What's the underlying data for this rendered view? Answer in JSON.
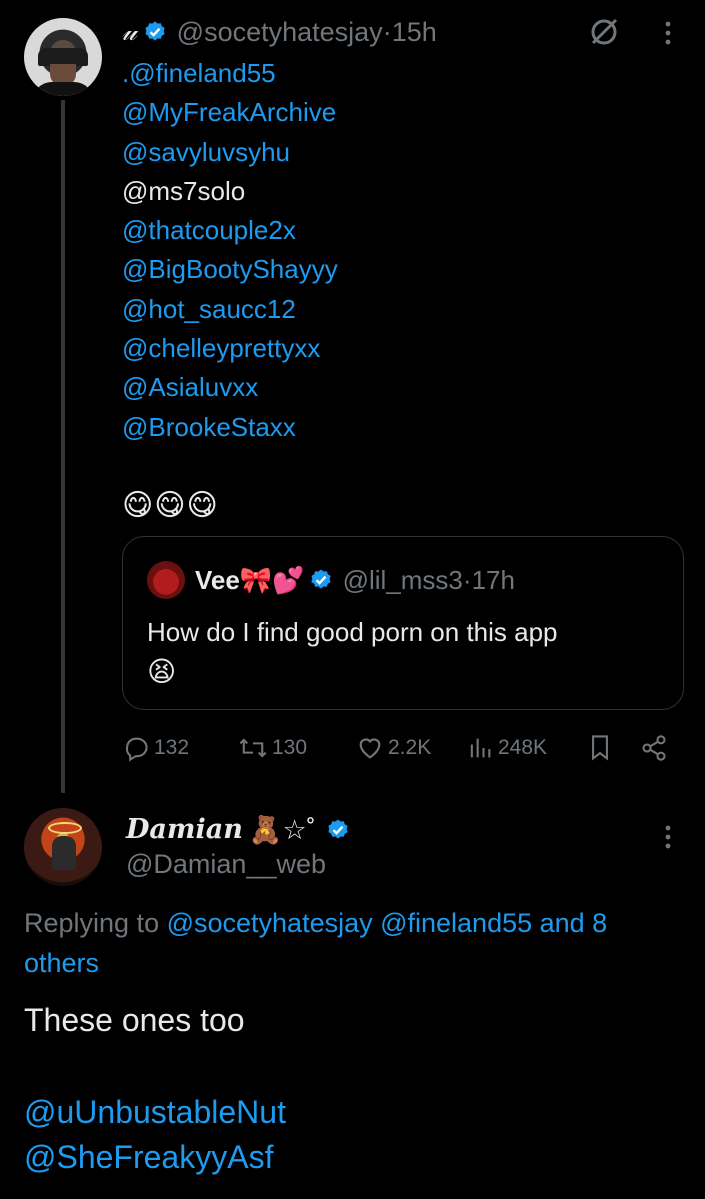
{
  "tweet1": {
    "author_glyph": "𝓊",
    "handle": "@socetyhatesjay",
    "time_sep": " · ",
    "time": "15h",
    "mentions": [
      {
        "text": ".@fineland55",
        "link": true
      },
      {
        "text": "@MyFreakArchive",
        "link": true
      },
      {
        "text": "@savyluvsyhu",
        "link": true
      },
      {
        "text": "@ms7solo",
        "link": false
      },
      {
        "text": "@thatcouple2x",
        "link": true
      },
      {
        "text": "@BigBootyShayyy",
        "link": true
      },
      {
        "text": "@hot_saucc12",
        "link": true
      },
      {
        "text": "@chelleyprettyxx",
        "link": true
      },
      {
        "text": "@Asialuvxx",
        "link": true
      },
      {
        "text": "@BrookeStaxx",
        "link": true
      }
    ],
    "emojis": "😋😋😋",
    "quote": {
      "name": "Vee🎀💕",
      "handle": "@lil_mss3",
      "time_sep": " · ",
      "time": "17h",
      "text": "How do I find good porn on this app",
      "emoji": "😫"
    },
    "actions": {
      "replies": "132",
      "retweets": "130",
      "likes": "2.2K",
      "views": "248K"
    }
  },
  "tweet2": {
    "name": "Damian",
    "name_decor": "🧸☆˚",
    "handle": "@Damian__web",
    "replying_prefix": "Replying to ",
    "replying_to": "@socetyhatesjay @fineland55 and 8 others",
    "text": "These ones too",
    "mentions": [
      "@uUnbustableNut",
      "@SheFreakyyAsf"
    ]
  },
  "colors": {
    "background": "#000000",
    "text": "#e7e9ea",
    "link": "#1d9bf0",
    "muted": "#71767b",
    "border": "#2f3336"
  }
}
